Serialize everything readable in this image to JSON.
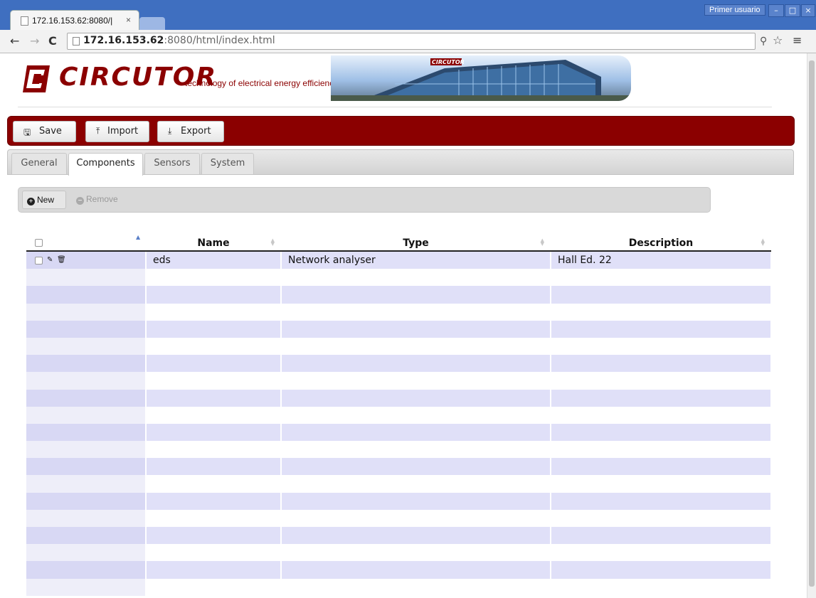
{
  "browser": {
    "tab_title": "172.16.153.62:8080/|",
    "tab_close": "×",
    "user_label": "Primer usuario",
    "url_host": "172.16.153.62",
    "url_rest": ":8080/html/index.html",
    "window_buttons": [
      "–",
      "□",
      "×"
    ]
  },
  "header": {
    "logo_text": "CIRCUTOR",
    "tagline": "technology of electrical energy efficiency",
    "banner_sign": "CIRCUTOR"
  },
  "toolbar": {
    "save_label": "Save",
    "import_label": "Import",
    "export_label": "Export"
  },
  "tabs": [
    {
      "label": "General",
      "active": false
    },
    {
      "label": "Components",
      "active": true
    },
    {
      "label": "Sensors",
      "active": false
    },
    {
      "label": "System",
      "active": false
    }
  ],
  "subtoolbar": {
    "new_label": "New",
    "remove_label": "Remove"
  },
  "table": {
    "columns": [
      "Name",
      "Type",
      "Description"
    ],
    "rows": [
      {
        "name": "eds",
        "type": "Network analyser",
        "description": "Hall Ed. 22"
      }
    ]
  },
  "colors": {
    "brand": "#8b0000",
    "chrome": "#3f6fc0",
    "row_stripe": "#e0e0f8"
  }
}
